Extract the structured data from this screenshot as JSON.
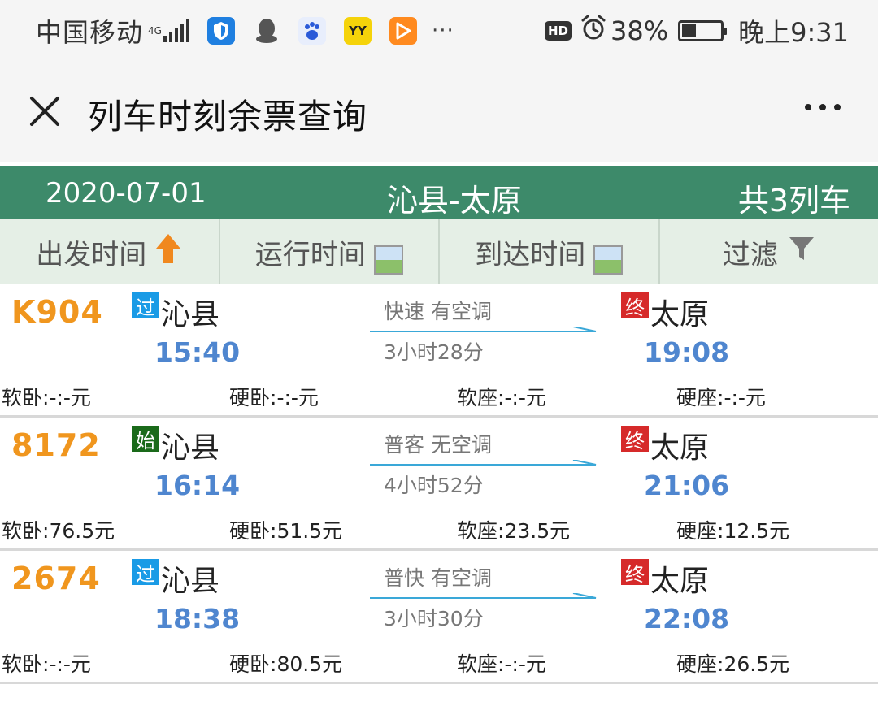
{
  "status_bar": {
    "carrier": "中国移动",
    "network": "4G",
    "battery_pct": "38%",
    "battery_level": 0.38,
    "clock": "晚上9:31",
    "hd_badge": "HD",
    "overflow": "···",
    "app_icons": [
      {
        "name": "shield",
        "color": "#1f7fe0"
      },
      {
        "name": "qq",
        "color": "#555555"
      },
      {
        "name": "baidu",
        "color": "#2a5ad8"
      },
      {
        "name": "yy",
        "color": "#f5d30a"
      },
      {
        "name": "video",
        "color": "#ff8a1f"
      }
    ]
  },
  "nav": {
    "title": "列车时刻余票查询"
  },
  "route_header": {
    "date": "2020-07-01",
    "route": "沁县-太原",
    "count": "共3列车"
  },
  "sort_tabs": [
    {
      "label": "出发时间",
      "icon": "arrow-up-icon"
    },
    {
      "label": "运行时间",
      "icon": "image-placeholder-icon"
    },
    {
      "label": "到达时间",
      "icon": "image-placeholder-icon"
    },
    {
      "label": "过滤",
      "icon": "filter-icon"
    }
  ],
  "trains": [
    {
      "number": "K904",
      "dep_tag": "过",
      "dep_station": "沁县",
      "dep_time": "15:40",
      "train_type": "快速  有空调",
      "duration": "3小时28分",
      "arr_tag": "终",
      "arr_station": "太原",
      "arr_time": "19:08",
      "prices": [
        {
          "label": "软卧:",
          "value": "-:-元"
        },
        {
          "label": "硬卧:",
          "value": "-:-元"
        },
        {
          "label": "软座:",
          "value": "-:-元"
        },
        {
          "label": "硬座:",
          "value": "-:-元"
        }
      ]
    },
    {
      "number": "8172",
      "dep_tag": "始",
      "dep_station": "沁县",
      "dep_time": "16:14",
      "train_type": "普客  无空调",
      "duration": "4小时52分",
      "arr_tag": "终",
      "arr_station": "太原",
      "arr_time": "21:06",
      "prices": [
        {
          "label": "软卧:",
          "value": "76.5元"
        },
        {
          "label": "硬卧:",
          "value": "51.5元"
        },
        {
          "label": "软座:",
          "value": "23.5元"
        },
        {
          "label": "硬座:",
          "value": "12.5元"
        }
      ]
    },
    {
      "number": "2674",
      "dep_tag": "过",
      "dep_station": "沁县",
      "dep_time": "18:38",
      "train_type": "普快  有空调",
      "duration": "3小时30分",
      "arr_tag": "终",
      "arr_station": "太原",
      "arr_time": "22:08",
      "prices": [
        {
          "label": "软卧:",
          "value": "-:-元"
        },
        {
          "label": "硬卧:",
          "value": "80.5元"
        },
        {
          "label": "软座:",
          "value": "-:-元"
        },
        {
          "label": "硬座:",
          "value": "26.5元"
        }
      ]
    }
  ]
}
